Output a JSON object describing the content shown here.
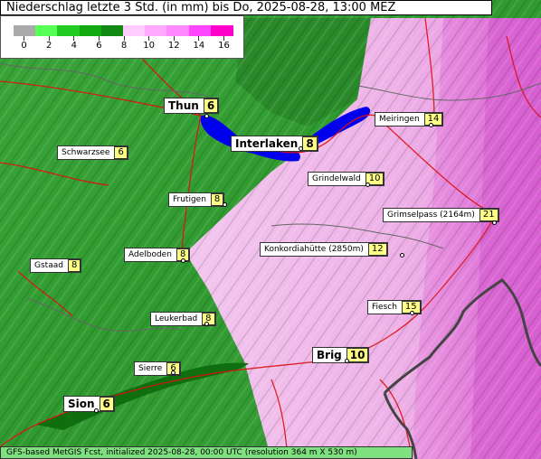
{
  "title": "Niederschlag letzte 3 Std. (in mm) bis Do, 2025-08-28, 13:00 MEZ",
  "legend": {
    "ticks": [
      "0",
      "2",
      "4",
      "6",
      "8",
      "10",
      "12",
      "14",
      "16"
    ],
    "colors": [
      "#aaaaaa",
      "#55ff55",
      "#22cc22",
      "#11aa11",
      "#118811",
      "#ffccff",
      "#ffaaff",
      "#ff88ff",
      "#ff44ff",
      "#ff00cc"
    ]
  },
  "places": [
    {
      "name": "Thun",
      "value": "6",
      "big": true
    },
    {
      "name": "Schwarzsee",
      "value": "6"
    },
    {
      "name": "Interlaken",
      "value": "8",
      "big": true
    },
    {
      "name": "Meiringen",
      "value": "14"
    },
    {
      "name": "Grindelwald",
      "value": "10"
    },
    {
      "name": "Frutigen",
      "value": "8"
    },
    {
      "name": "Grimselpass (2164m)",
      "value": "21"
    },
    {
      "name": "Adelboden",
      "value": "8"
    },
    {
      "name": "Konkordiahütte (2850m)",
      "value": "12"
    },
    {
      "name": "Gstaad",
      "value": "8"
    },
    {
      "name": "Fiesch",
      "value": "15"
    },
    {
      "name": "Leukerbad",
      "value": "8"
    },
    {
      "name": "Brig",
      "value": "10",
      "big": true
    },
    {
      "name": "Sierre",
      "value": "6"
    },
    {
      "name": "Sion",
      "value": "6",
      "big": true
    }
  ],
  "footer": "GFS-based MetGIS Fcst, initialized 2025-08-28, 00:00 UTC  (resolution 364 m X 530 m)"
}
